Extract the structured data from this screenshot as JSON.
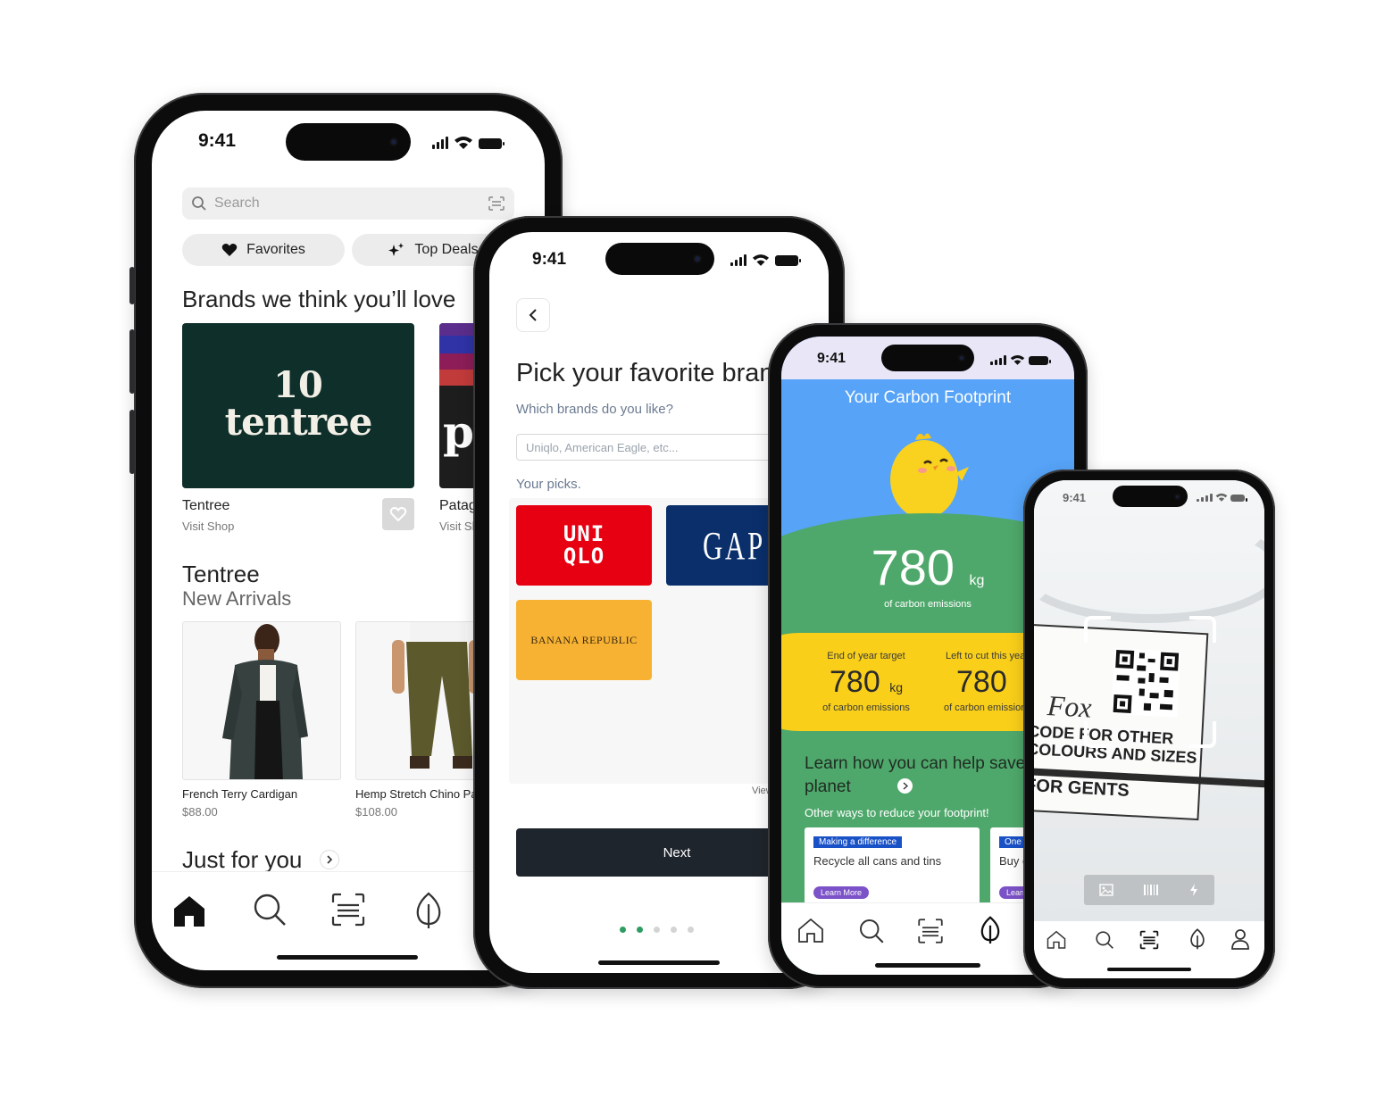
{
  "status_time": "9:41",
  "phone1": {
    "search_placeholder": "Search",
    "chips": [
      {
        "label": "Favorites",
        "icon": "heart-icon"
      },
      {
        "label": "Top Deals",
        "icon": "sparkle-icon"
      }
    ],
    "brands_title": "Brands we think you’ll love",
    "brand_logo_number": "10",
    "brand_logo_word": "tentree",
    "brands": [
      {
        "name": "Tentree",
        "action": "Visit Shop"
      },
      {
        "name": "Patagonia",
        "action": "Visit Shop"
      }
    ],
    "patagonia_logo_letter": "p",
    "section_title": "Tentree",
    "section_subtitle": "New Arrivals",
    "products": [
      {
        "name": "French Terry Cardigan",
        "price": "$88.00"
      },
      {
        "name": "Hemp Stretch Chino Pant",
        "price": "$108.00"
      }
    ],
    "just_for_you": "Just for you"
  },
  "phone2": {
    "title": "Pick your favorite brands",
    "question": "Which brands do you like?",
    "input_placeholder": "Uniqlo, American Eagle, etc...",
    "picks_label": "Your picks.",
    "picks": [
      {
        "line1": "UNI",
        "line2": "QLO",
        "bg": "#e60012"
      },
      {
        "line1": "GAP",
        "line2": "",
        "bg": "#0a2f6b"
      },
      {
        "line1": "BANANA REPUBLIC",
        "line2": "",
        "bg": "#f7b233"
      }
    ],
    "view_all": "View all",
    "next": "Next",
    "page_dots": 5,
    "active_dot": 2
  },
  "phone3": {
    "header": "Your Carbon Footprint",
    "value": "780",
    "unit": "kg",
    "value_caption": "of carbon emissions",
    "target_label": "End of year target",
    "target_value": "780",
    "target_unit": "kg",
    "target_caption": "of carbon emissions",
    "left_label": "Left to cut this year",
    "left_value": "780",
    "left_caption": "of carbon emissions",
    "learn": "Learn how you can help save our planet",
    "other_ways": "Other ways to reduce your footprint!",
    "cards": [
      {
        "tag": "Making a difference",
        "text": "Recycle all cans and tins",
        "btn": "Learn More"
      },
      {
        "tag": "One step",
        "text": "Buy clothes second hand",
        "btn": "Learn More"
      }
    ],
    "colors": {
      "sky": "#56a3f7",
      "grass": "#4fa86b",
      "sun": "#f9cf1a",
      "tag": "#1951c7",
      "btn": "#7b52c7"
    }
  },
  "phone4": {
    "label_lines": [
      "CODE FOR OTHER",
      "COLOURS AND SIZES",
      "FOR GENTS"
    ],
    "label_brand": "Fox"
  }
}
